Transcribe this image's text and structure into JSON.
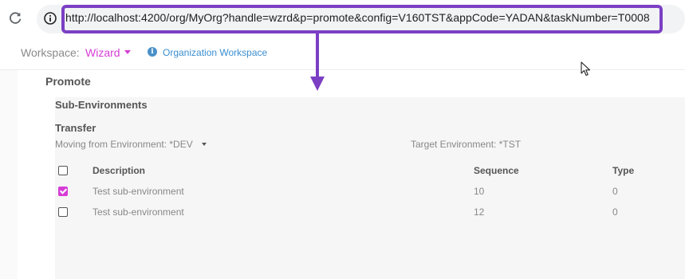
{
  "browser": {
    "url": "http://localhost:4200/org/MyOrg?handle=wzrd&p=promote&config=V160TST&appCode=YADAN&taskNumber=T0008"
  },
  "header": {
    "workspace_label": "Workspace:",
    "workspace_value": "Wizard",
    "org_link": "Organization Workspace"
  },
  "page": {
    "title": "Promote"
  },
  "sub_environments": {
    "title": "Sub-Environments",
    "transfer_title": "Transfer",
    "moving_from": "Moving from Environment: *DEV",
    "target": "Target Environment: *TST",
    "columns": [
      "Description",
      "Sequence",
      "Type"
    ],
    "rows": [
      {
        "description": "Test sub-environment",
        "sequence": "10",
        "type": "0",
        "checked": true
      },
      {
        "description": "Test sub-environment",
        "sequence": "12",
        "type": "0",
        "checked": false
      }
    ]
  },
  "colors": {
    "accent": "#d63dd6",
    "highlight": "#7b3fc4",
    "link": "#3b8ed0"
  }
}
